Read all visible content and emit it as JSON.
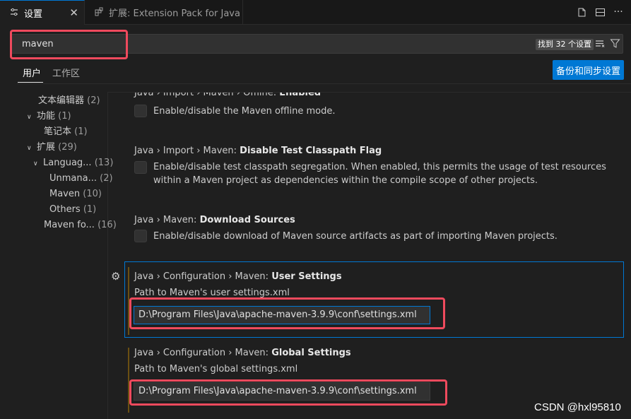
{
  "tabs": [
    {
      "label": "设置",
      "icon": "settings-sliders-icon"
    },
    {
      "label": "扩展: Extension Pack for Java",
      "icon": "extensions-icon"
    }
  ],
  "search": {
    "value": "maven",
    "result_count": "找到 32 个设置"
  },
  "scope": {
    "user": "用户",
    "workspace": "工作区"
  },
  "sync_button": "备份和同步设置",
  "tree": [
    {
      "label": "文本编辑器",
      "count": "(2)"
    },
    {
      "label": "功能",
      "count": "(1)"
    },
    {
      "label": "笔记本",
      "count": "(1)"
    },
    {
      "label": "扩展",
      "count": "(29)"
    },
    {
      "label": "Languag...",
      "count": "(13)"
    },
    {
      "label": "Unmana...",
      "count": "(2)"
    },
    {
      "label": "Maven",
      "count": "(10)"
    },
    {
      "label": "Others",
      "count": "(1)"
    },
    {
      "label": "Maven fo...",
      "count": "(16)"
    }
  ],
  "settings": [
    {
      "prefix": "Java › Import › Maven › Offline: ",
      "name": "Enabled",
      "desc": "Enable/disable the Maven offline mode."
    },
    {
      "prefix": "Java › Import › Maven: ",
      "name": "Disable Test Classpath Flag",
      "desc": "Enable/disable test classpath segregation. When enabled, this permits the usage of test resources within a Maven project as dependencies within the compile scope of other projects."
    },
    {
      "prefix": "Java › Maven: ",
      "name": "Download Sources",
      "desc": "Enable/disable download of Maven source artifacts as part of importing Maven projects."
    },
    {
      "prefix": "Java › Configuration › Maven: ",
      "name": "User Settings",
      "desc": "Path to Maven's user settings.xml",
      "value": "D:\\Program Files\\Java\\apache-maven-3.9.9\\conf\\settings.xml"
    },
    {
      "prefix": "Java › Configuration › Maven: ",
      "name": "Global Settings",
      "desc": "Path to Maven's global settings.xml",
      "value": "D:\\Program Files\\Java\\apache-maven-3.9.9\\conf\\settings.xml"
    }
  ],
  "watermark": "CSDN @hxl95810",
  "colors": {
    "accent": "#0078d4",
    "highlight": "#ef4a5d",
    "background": "#1f1f1f"
  }
}
